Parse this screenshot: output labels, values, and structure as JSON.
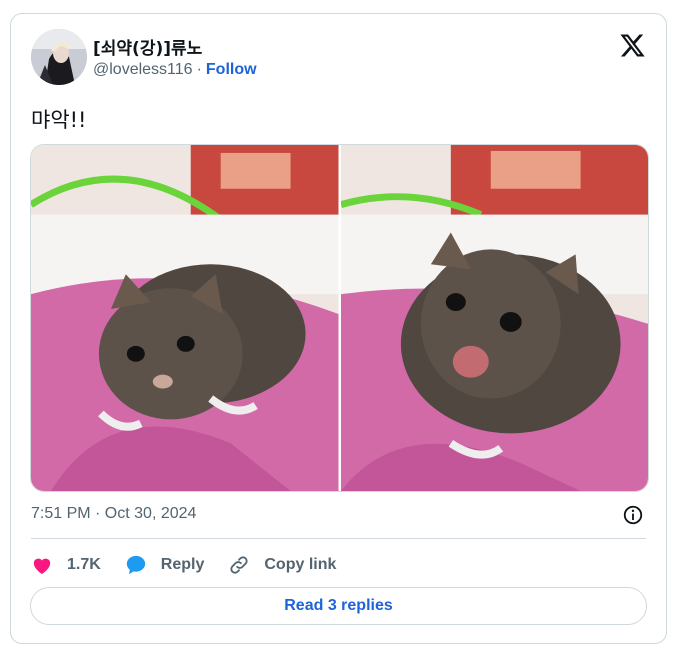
{
  "author": {
    "display_name": "[쇠약(강)]류노",
    "handle": "@loveless116",
    "separator": "·",
    "follow_label": "Follow"
  },
  "tweet": {
    "text": "먀악!!",
    "timestamp": "7:51 PM · Oct 30, 2024"
  },
  "actions": {
    "like_count": "1.7K",
    "reply_label": "Reply",
    "copy_link_label": "Copy link"
  },
  "read_replies_label": "Read 3 replies",
  "colors": {
    "accent": "#1d64d8",
    "like": "#f91880",
    "reply_icon": "#1d9bf0",
    "muted": "#536471",
    "border": "#cfd9de"
  },
  "icons": [
    "x-logo-icon",
    "info-icon",
    "heart-icon",
    "reply-bubble-icon",
    "link-icon"
  ]
}
